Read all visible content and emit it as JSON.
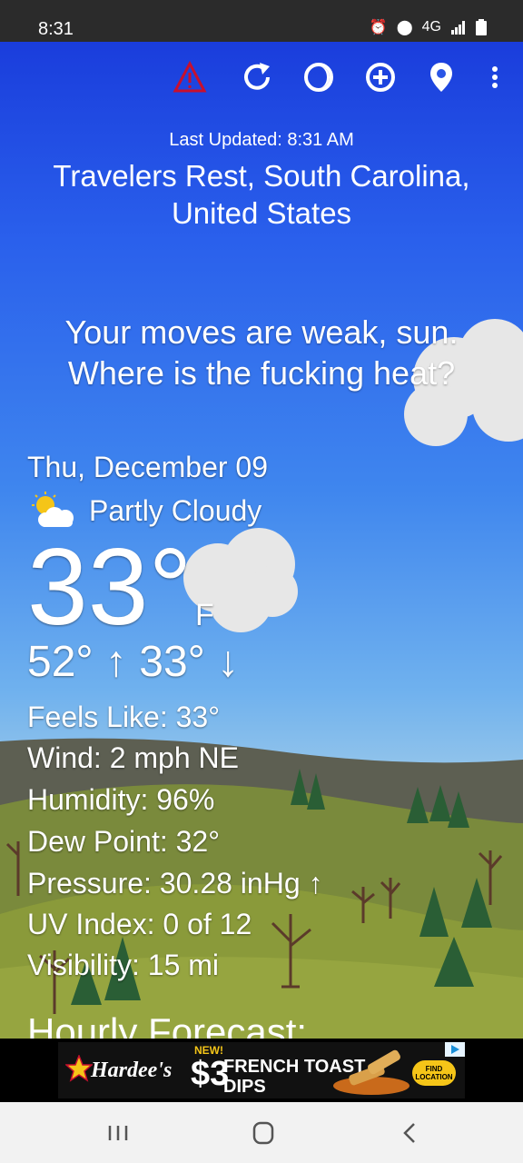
{
  "status_bar": {
    "time": "8:31",
    "network": "4G"
  },
  "toolbar": {
    "icons": [
      "alert-icon",
      "refresh-icon",
      "theme-icon",
      "add-location-icon",
      "location-pin-icon",
      "more-icon"
    ],
    "alert_color": "#c8102e"
  },
  "header": {
    "last_updated": "Last Updated: 8:31 AM",
    "location_line1": "Travelers Rest, South Carolina,",
    "location_line2": "United States"
  },
  "quote": {
    "line1": "Your moves are weak, sun.",
    "line2": "Where is the fucking heat?"
  },
  "current": {
    "date": "Thu, December 09",
    "condition": "Partly Cloudy",
    "temperature": "33°",
    "unit": "F",
    "high_low": "52° ↑ 33° ↓"
  },
  "details": [
    "Feels Like:  33°",
    "Wind:  2 mph NE",
    "Humidity:  96%",
    "Dew Point:  32°",
    "Pressure:  30.28 inHg ↑",
    "UV Index:  0 of 12",
    "Visibility:  15 mi"
  ],
  "hourly_title": "Hourly Forecast:",
  "ad": {
    "brand": "Hardee's",
    "badge": "NEW!",
    "price": "$3",
    "product_line1": "FRENCH TOAST",
    "product_line2": "DIPS",
    "cta": "FIND LOCATION"
  },
  "colors": {
    "sky_top": "#1a3ddc",
    "hill": "#7a8a3c",
    "brand_yellow": "#f5c518"
  }
}
